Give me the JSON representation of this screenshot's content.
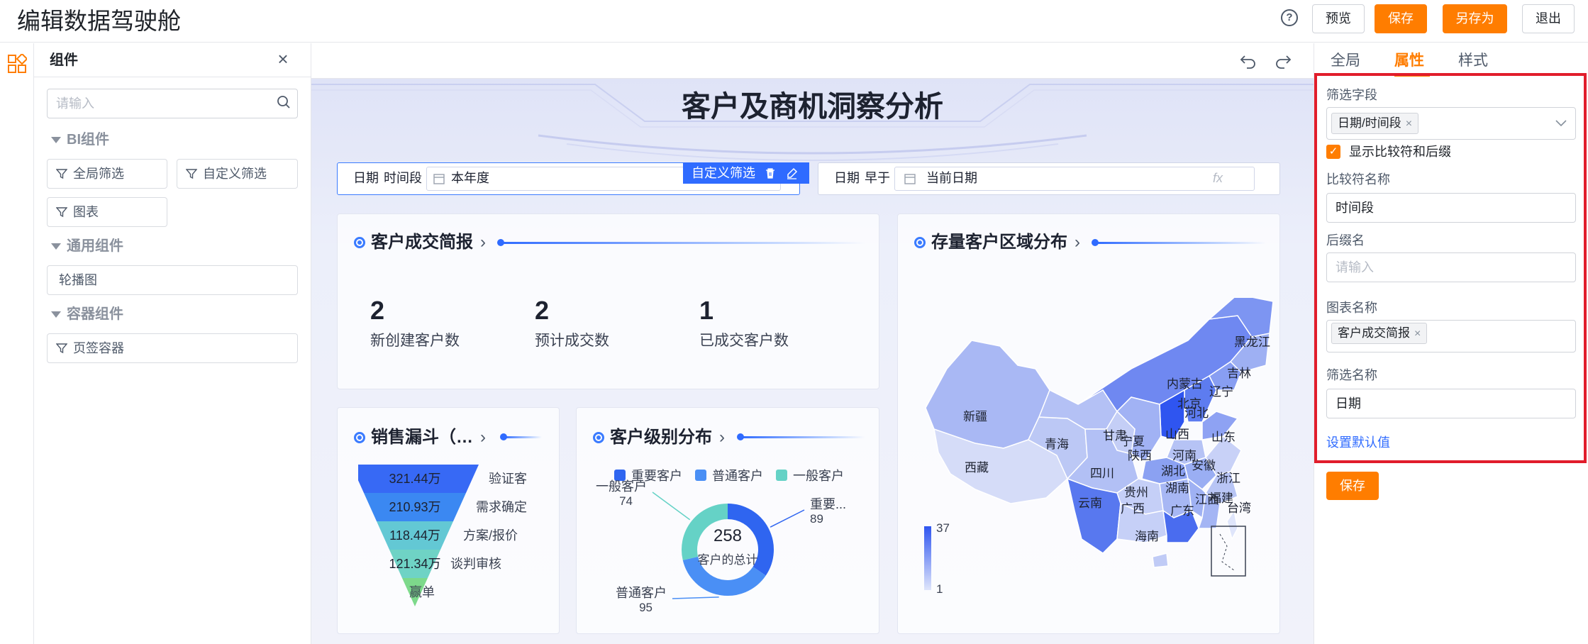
{
  "header": {
    "title": "编辑数据驾驶舱",
    "help_icon": "?",
    "buttons": {
      "preview": "预览",
      "save": "保存",
      "save_as": "另存为",
      "exit": "退出"
    }
  },
  "components_panel": {
    "title": "组件",
    "search_placeholder": "请输入",
    "groups": [
      {
        "label": "BI组件",
        "items": [
          "全局筛选",
          "自定义筛选",
          "图表"
        ]
      },
      {
        "label": "通用组件",
        "items": [
          "轮播图"
        ]
      },
      {
        "label": "容器组件",
        "items": [
          "页签容器"
        ]
      }
    ]
  },
  "dashboard": {
    "title": "客户及商机洞察分析",
    "filters": {
      "f1_label": "日期",
      "f1_sub": "时间段",
      "f1_value": "本年度",
      "f1_badge": "自定义筛选",
      "f2_label": "日期",
      "f2_sub": "早于",
      "f2_value": "当前日期",
      "f2_fx": "fx"
    },
    "cards": {
      "summary": {
        "title": "客户成交简报",
        "kpis": [
          {
            "value": "2",
            "label": "新创建客户数"
          },
          {
            "value": "2",
            "label": "预计成交数"
          },
          {
            "value": "1",
            "label": "已成交客户数"
          }
        ]
      },
      "funnel_title": "销售漏斗（…",
      "level_title": "客户级别分布",
      "region_title": "存量客户区域分布"
    }
  },
  "chart_data": [
    {
      "type": "funnel",
      "stages": [
        "验证客",
        "需求确定",
        "方案/报价",
        "谈判审核",
        "赢单"
      ],
      "values": [
        321.44,
        210.93,
        118.44,
        121.34,
        null
      ],
      "value_labels": [
        "321.44万",
        "210.93万",
        "118.44万",
        "121.34万",
        ""
      ],
      "colors": [
        "#3769f5",
        "#3b88f2",
        "#63c8d4",
        "#6fd3c5",
        "#7dd98b"
      ]
    },
    {
      "type": "pie",
      "donut": true,
      "center_value": "258",
      "center_label": "客户的总计",
      "legend": [
        "重要客户",
        "普通客户",
        "一般客户"
      ],
      "slices": [
        {
          "name": "重要客户",
          "label": "重要...",
          "value": 89,
          "color": "#2f65f0"
        },
        {
          "name": "普通客户",
          "label": "普通客户",
          "value": 95,
          "color": "#4a8ff5"
        },
        {
          "name": "一般客户",
          "label": "一般客户",
          "value": 74,
          "color": "#65d2c6"
        }
      ]
    },
    {
      "type": "map",
      "region": "China",
      "scale": {
        "min": 1,
        "max": 37
      },
      "labels": [
        "黑龙江",
        "吉林",
        "辽宁",
        "内蒙古",
        "河北",
        "北京",
        "山西",
        "山东",
        "河南",
        "甘肃",
        "宁夏",
        "陕西",
        "青海",
        "新疆",
        "西藏",
        "四川",
        "湖北",
        "安徽",
        "浙江",
        "贵州",
        "湖南",
        "江西",
        "福建",
        "云南",
        "广西",
        "广东",
        "台湾",
        "海南"
      ]
    }
  ],
  "right_panel": {
    "tabs": [
      "全局",
      "属性",
      "样式"
    ],
    "active_tab": "属性",
    "filter_field_label": "筛选字段",
    "filter_field_tag": "日期/时间段",
    "show_compare_label": "显示比较符和后缀",
    "compare_name_label": "比较符名称",
    "compare_name_value": "时间段",
    "suffix_label": "后缀名",
    "suffix_placeholder": "请输入",
    "chart_name_label": "图表名称",
    "chart_name_tag": "客户成交简报",
    "filter_name_label": "筛选名称",
    "filter_name_value": "日期",
    "set_default": "设置默认值",
    "save_button": "保存"
  },
  "colors": {
    "accent": "#ff7d00",
    "highlight": "#e11d2b",
    "chart_blue": "#2f6bff"
  }
}
